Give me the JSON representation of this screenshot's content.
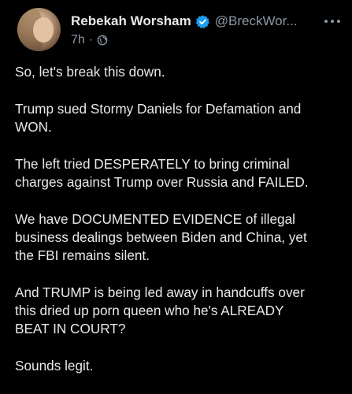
{
  "author": {
    "display_name": "Rebekah Worsham",
    "handle": "@BreckWor...",
    "verified": true
  },
  "meta": {
    "time": "7h",
    "separator": "·"
  },
  "icons": {
    "verified": "verified-badge-icon",
    "audience": "globe-icon",
    "menu": "more-options-icon"
  },
  "colors": {
    "background": "#000000",
    "text": "#e7e9ea",
    "secondary": "#8b98a5",
    "verified": "#1d9bf0"
  },
  "paragraphs": [
    "So, let's break this down.",
    "Trump sued Stormy Daniels for Defamation and\nWON.",
    "The left tried DESPERATELY to bring criminal\ncharges against Trump over Russia and FAILED.",
    "We have DOCUMENTED EVIDENCE of illegal\nbusiness dealings between Biden and China, yet\nthe FBI remains silent.",
    "And TRUMP is being led away in handcuffs over\nthis dried up porn queen who he's ALREADY\nBEAT IN COURT?",
    "Sounds legit."
  ]
}
